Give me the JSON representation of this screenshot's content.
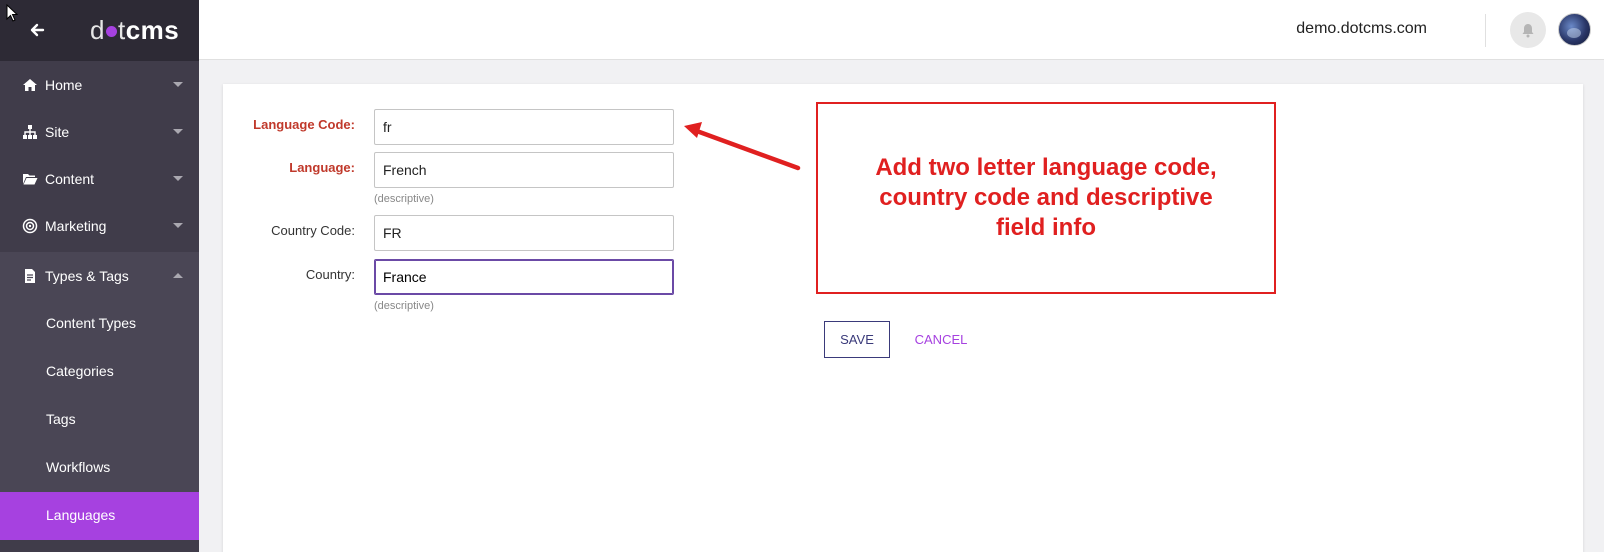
{
  "sidebar": {
    "logo": {
      "part1": "d",
      "part2": "t",
      "part3": "cms"
    },
    "nav": [
      {
        "label": "Home",
        "icon": "home-icon"
      },
      {
        "label": "Site",
        "icon": "sitemap-icon"
      },
      {
        "label": "Content",
        "icon": "folder-icon"
      },
      {
        "label": "Marketing",
        "icon": "target-icon"
      },
      {
        "label": "Types & Tags",
        "icon": "document-icon"
      }
    ],
    "sub_items": [
      {
        "label": "Content Types"
      },
      {
        "label": "Categories"
      },
      {
        "label": "Tags"
      },
      {
        "label": "Workflows"
      },
      {
        "label": "Languages",
        "active": true
      }
    ]
  },
  "header": {
    "site_name": "demo.dotcms.com"
  },
  "form": {
    "language_code": {
      "label": "Language Code:",
      "value": "fr"
    },
    "language": {
      "label": "Language:",
      "value": "French",
      "hint": "(descriptive)"
    },
    "country_code": {
      "label": "Country Code:",
      "value": "FR"
    },
    "country": {
      "label": "Country:",
      "value": "France",
      "hint": "(descriptive)"
    }
  },
  "annotation": {
    "text": "Add two letter language code, country code and descriptive field info",
    "color": "#e02020"
  },
  "actions": {
    "save_label": "SAVE",
    "cancel_label": "CANCEL"
  },
  "colors": {
    "accent": "#a641e0",
    "sidebar_bg": "#403c4a",
    "required_label": "#c0392b"
  }
}
